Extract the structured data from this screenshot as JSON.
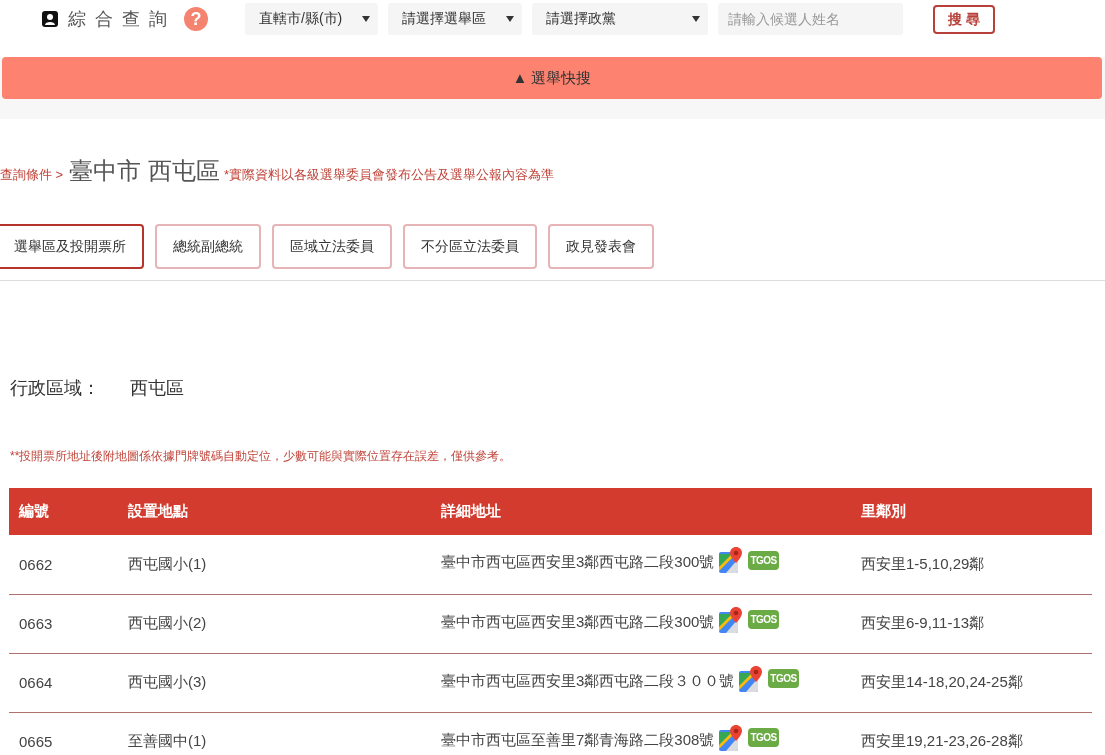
{
  "header": {
    "title": "綜合查詢",
    "help": "?",
    "selects": [
      {
        "value": "直轄市/縣(市)"
      },
      {
        "value": "請選擇選舉區"
      },
      {
        "value": "請選擇政黨"
      }
    ],
    "search_input": {
      "placeholder": "請輸入候選人姓名"
    },
    "search_button": "搜尋"
  },
  "quick_search": {
    "label": "▲ 選舉快搜"
  },
  "breadcrumb": {
    "prefix": "查詢條件 >",
    "location": "臺中市 西屯區",
    "notice": "*實際資料以各級選舉委員會發布公告及選舉公報內容為準"
  },
  "tabs": [
    {
      "label": "選舉區及投開票所",
      "selected": true
    },
    {
      "label": "總統副總統",
      "selected": false
    },
    {
      "label": "區域立法委員",
      "selected": false
    },
    {
      "label": "不分區立法委員",
      "selected": false
    },
    {
      "label": "政見發表會",
      "selected": false
    }
  ],
  "district": {
    "label": "行政區域：",
    "value": "西屯區"
  },
  "map_note": "**投開票所地址後附地圖係依據門牌號碼自動定位，少數可能與實際位置存在誤差，僅供參考。",
  "table": {
    "columns": [
      "編號",
      "設置地點",
      "詳細地址",
      "里鄰別"
    ],
    "rows": [
      {
        "number": "0662",
        "location": "西屯國小(1)",
        "address": "臺中市西屯區西安里3鄰西屯路二段300號",
        "tgos": "TGOS",
        "village": "西安里1-5,10,29鄰"
      },
      {
        "number": "0663",
        "location": "西屯國小(2)",
        "address": "臺中市西屯區西安里3鄰西屯路二段300號",
        "tgos": "TGOS",
        "village": "西安里6-9,11-13鄰"
      },
      {
        "number": "0664",
        "location": "西屯國小(3)",
        "address": "臺中市西屯區西安里3鄰西屯路二段３００號",
        "tgos": "TGOS",
        "village": "西安里14-18,20,24-25鄰"
      },
      {
        "number": "0665",
        "location": "至善國中(1)",
        "address": "臺中市西屯區至善里7鄰青海路二段308號",
        "tgos": "TGOS",
        "village": "西安里19,21-23,26-28鄰"
      }
    ]
  }
}
